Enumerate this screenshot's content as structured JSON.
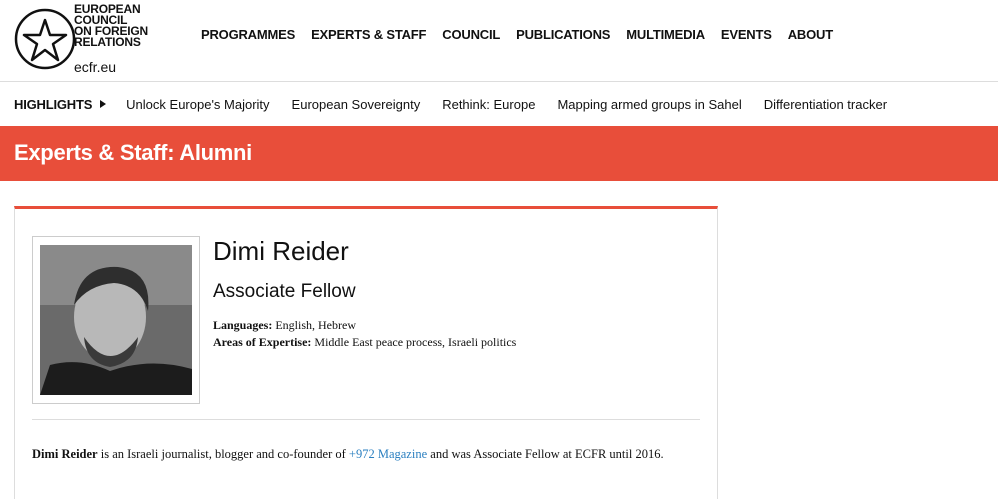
{
  "logo": {
    "lines": [
      "EUROPEAN",
      "COUNCIL",
      "ON FOREIGN",
      "RELATIONS"
    ],
    "url": "ecfr.eu"
  },
  "nav": [
    "PROGRAMMES",
    "EXPERTS & STAFF",
    "COUNCIL",
    "PUBLICATIONS",
    "MULTIMEDIA",
    "EVENTS",
    "ABOUT"
  ],
  "highlights": {
    "label": "HIGHLIGHTS",
    "links": [
      "Unlock Europe's Majority",
      "European Sovereignty",
      "Rethink: Europe",
      "Mapping armed groups in Sahel",
      "Differentiation tracker"
    ]
  },
  "page_title": "Experts & Staff: Alumni",
  "profile": {
    "name": "Dimi Reider",
    "role": "Associate Fellow",
    "languages_label": "Languages:",
    "languages_value": "English, Hebrew",
    "expertise_label": "Areas of Expertise:",
    "expertise_value": "Middle East peace process, Israeli politics",
    "bio_name": "Dimi Reider",
    "bio_part1": " is an Israeli journalist, blogger and co-founder of ",
    "bio_link": "+972 Magazine",
    "bio_part2": " and was Associate Fellow at ECFR until 2016."
  },
  "colors": {
    "accent": "#e84e3a",
    "link": "#2a7fc0"
  }
}
